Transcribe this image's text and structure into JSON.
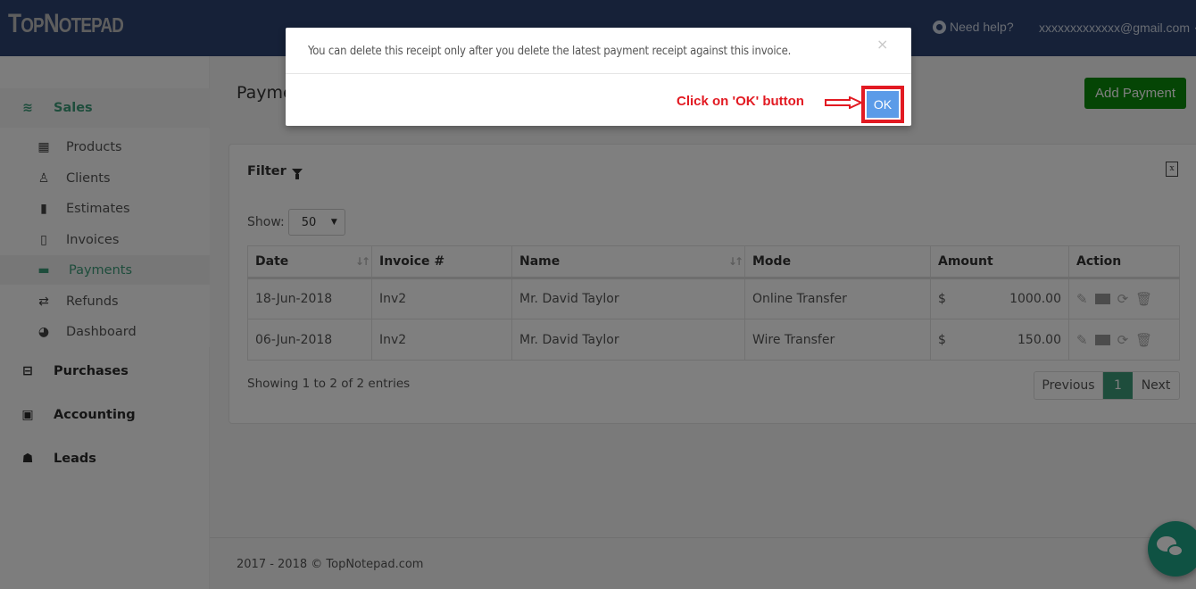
{
  "app": {
    "logo_big1": "T",
    "logo_small1": "OP",
    "logo_big2": "N",
    "logo_small2": "OTEPAD",
    "help_label": "Need help?",
    "user_email": "xxxxxxxxxxxxx@gmail.com"
  },
  "sidebar": {
    "groups": [
      {
        "label": "Sales",
        "icon": "layers-icon",
        "active": true
      },
      {
        "label": "Purchases",
        "icon": "minus-square-icon"
      },
      {
        "label": "Accounting",
        "icon": "bar-chart-icon"
      },
      {
        "label": "Leads",
        "icon": "users-icon"
      }
    ],
    "sales_items": [
      {
        "label": "Products",
        "icon": "cubes-icon"
      },
      {
        "label": "Clients",
        "icon": "user-outline-icon"
      },
      {
        "label": "Estimates",
        "icon": "file-icon"
      },
      {
        "label": "Invoices",
        "icon": "file-outline-icon"
      },
      {
        "label": "Payments",
        "icon": "credit-card-icon",
        "active": true
      },
      {
        "label": "Refunds",
        "icon": "exchange-icon"
      },
      {
        "label": "Dashboard",
        "icon": "dashboard-icon"
      }
    ]
  },
  "main": {
    "title": "Payments",
    "add_button": "Add Payment",
    "filter_label": "Filter",
    "show_label": "Show:",
    "page_size": "50",
    "table": {
      "columns": [
        "Date",
        "Invoice #",
        "Name",
        "Mode",
        "Amount",
        "Action"
      ],
      "rows": [
        {
          "date": "18-Jun-2018",
          "invoice": "Inv2",
          "name": "Mr. David Taylor",
          "mode": "Online Transfer",
          "currency": "$",
          "amount": "1000.00"
        },
        {
          "date": "06-Jun-2018",
          "invoice": "Inv2",
          "name": "Mr. David Taylor",
          "mode": "Wire Transfer",
          "currency": "$",
          "amount": "150.00"
        }
      ]
    },
    "showing_text": "Showing 1 to 2 of 2 entries",
    "pager": {
      "previous": "Previous",
      "current": "1",
      "next": "Next"
    }
  },
  "footer": {
    "text": "2017 - 2018 © TopNotepad.com"
  },
  "modal": {
    "message": "You can delete this receipt only after you delete the latest payment receipt against this invoice.",
    "close": "×",
    "ok_label": "OK",
    "annotation": "Click on 'OK' button"
  },
  "colors": {
    "topbar": "#2c4270",
    "accent_green": "#3c9a78",
    "add_button": "#0b8a0b",
    "ok_button": "#5b9be8",
    "annotation_red": "#e21a22"
  }
}
